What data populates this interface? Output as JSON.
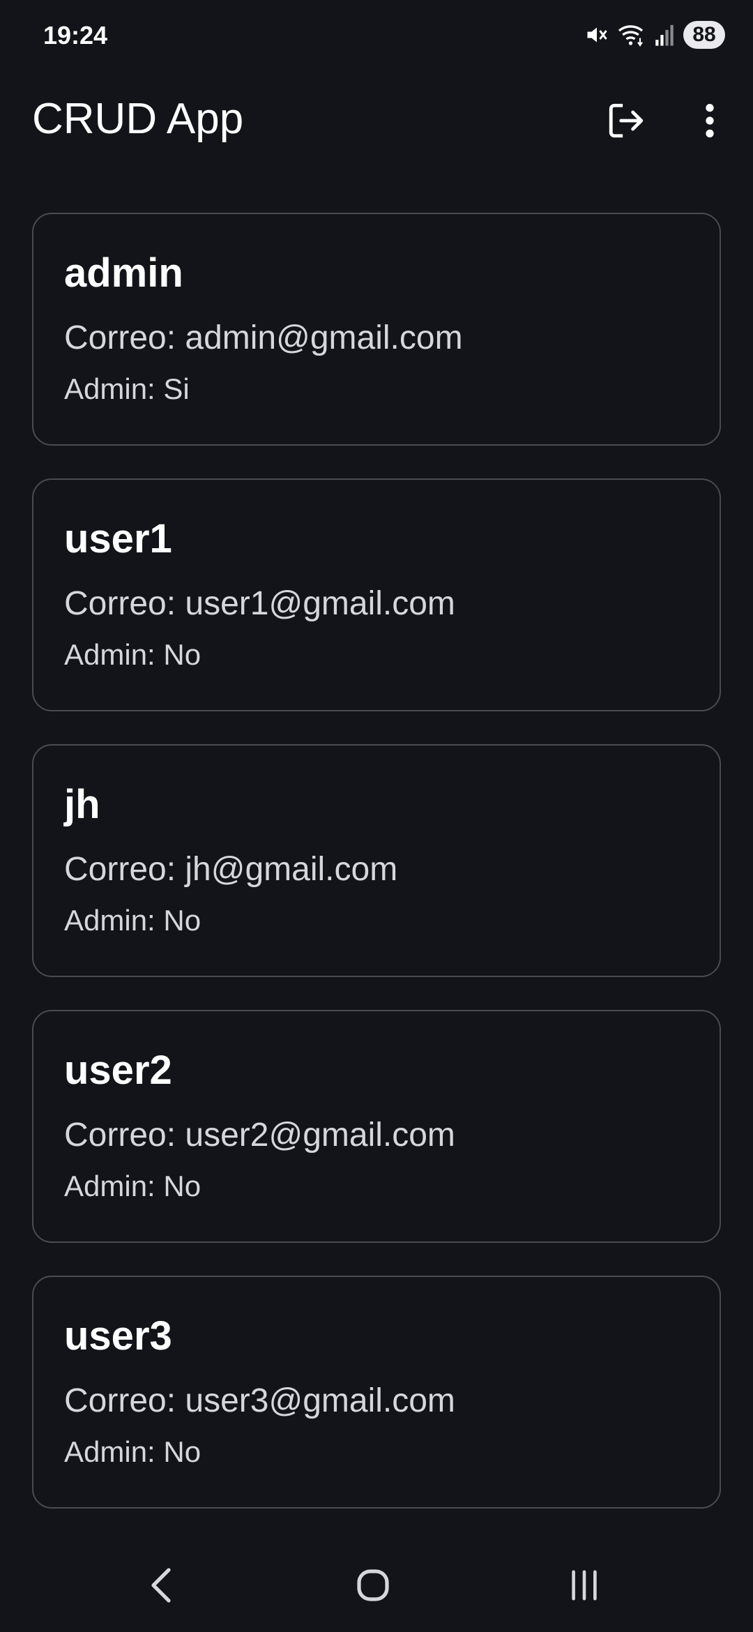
{
  "status_bar": {
    "time": "19:24",
    "battery": "88",
    "icons": [
      "mute-icon",
      "wifi-icon",
      "signal-icon",
      "battery-icon"
    ]
  },
  "app_bar": {
    "title": "CRUD App",
    "icons": [
      "logout-icon",
      "more-vert-icon"
    ]
  },
  "users": [
    {
      "name": "admin",
      "email_label": "Correo: admin@gmail.com",
      "admin_label": "Admin: Si"
    },
    {
      "name": "user1",
      "email_label": "Correo: user1@gmail.com",
      "admin_label": "Admin: No"
    },
    {
      "name": "jh",
      "email_label": "Correo: jh@gmail.com",
      "admin_label": "Admin: No"
    },
    {
      "name": "user2",
      "email_label": "Correo: user2@gmail.com",
      "admin_label": "Admin: No"
    },
    {
      "name": "user3",
      "email_label": "Correo: user3@gmail.com",
      "admin_label": "Admin: No"
    }
  ],
  "nav_bar": {
    "icons": [
      "back-icon",
      "home-icon",
      "recents-icon"
    ]
  },
  "colors": {
    "background": "#131419",
    "card_border": "#4a4b52",
    "text_primary": "#ffffff",
    "text_secondary": "#d6d6dc"
  }
}
